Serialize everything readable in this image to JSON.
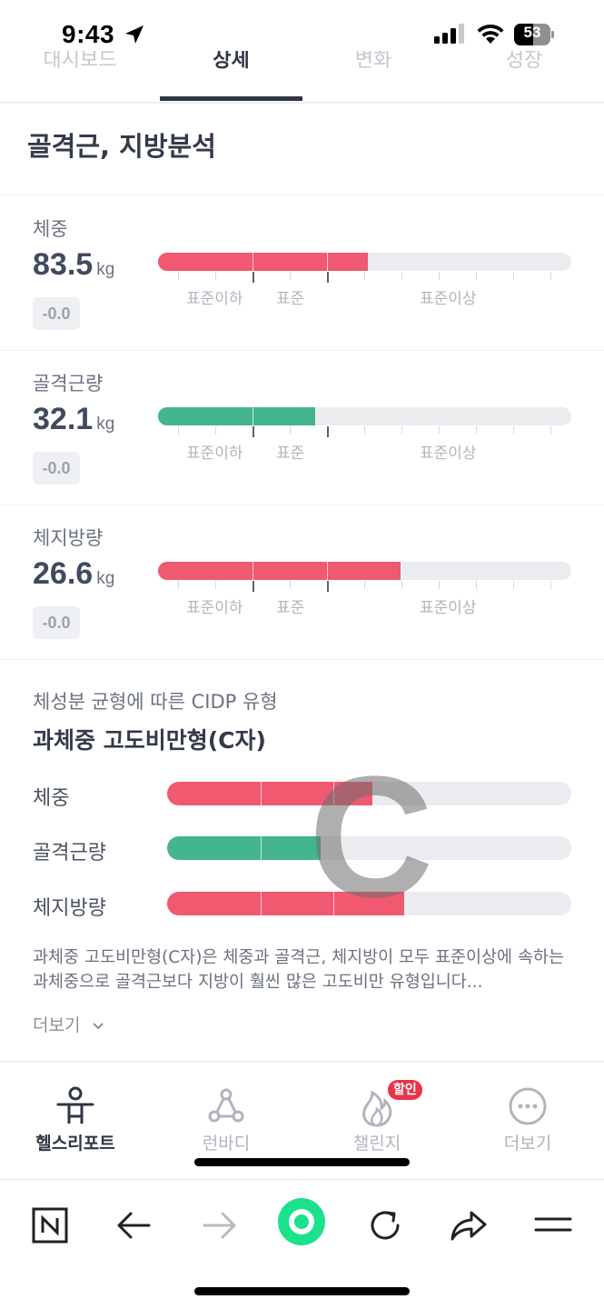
{
  "status_bar": {
    "time": "9:43",
    "battery": "53",
    "battery_level": 0.53
  },
  "tabs": [
    {
      "label": "대시보드",
      "active": false
    },
    {
      "label": "상세",
      "active": true
    },
    {
      "label": "변화",
      "active": false
    },
    {
      "label": "성장",
      "active": false
    }
  ],
  "section_title": "골격근, 지방분석",
  "colors": {
    "over": "#f0596f",
    "normal": "#44b58e",
    "track": "#eaecef"
  },
  "metrics": [
    {
      "label": "체중",
      "value": "83.5",
      "unit": "kg",
      "change": "-0.0",
      "fill_fraction": 0.507,
      "status": "over"
    },
    {
      "label": "골격근량",
      "value": "32.1",
      "unit": "kg",
      "change": "-0.0",
      "fill_fraction": 0.38,
      "status": "normal"
    },
    {
      "label": "체지방량",
      "value": "26.6",
      "unit": "kg",
      "change": "-0.0",
      "fill_fraction": 0.587,
      "status": "over"
    }
  ],
  "range_labels": {
    "below": "표준이하",
    "standard": "표준",
    "above": "표준이상"
  },
  "cidp": {
    "subtitle": "체성분 균형에 따른 CIDP 유형",
    "title": "과체중 고도비만형(C자)",
    "letter": "C",
    "rows": [
      {
        "label": "체중",
        "fill_fraction": 0.507,
        "status": "over"
      },
      {
        "label": "골격근량",
        "fill_fraction": 0.38,
        "status": "normal"
      },
      {
        "label": "체지방량",
        "fill_fraction": 0.587,
        "status": "over"
      }
    ],
    "description": "과체중 고도비만형(C자)은 체중과 골격근, 체지방이 모두 표준이상에 속하는 과체중으로 골격근보다 지방이 훨씬 많은 고도비만 유형입니다...",
    "more_label": "더보기"
  },
  "app_nav": [
    {
      "label": "헬스리포트",
      "icon": "person-icon",
      "active": true
    },
    {
      "label": "런바디",
      "icon": "molecule-icon",
      "active": false
    },
    {
      "label": "챌린지",
      "icon": "flame-icon",
      "active": false,
      "badge": "할인"
    },
    {
      "label": "더보기",
      "icon": "more-dots-icon",
      "active": false
    }
  ],
  "browser_bar": {
    "buttons": [
      "naver-n-icon",
      "back-arrow-icon",
      "forward-arrow-icon",
      "green-home-icon",
      "reload-icon",
      "share-icon",
      "menu-icon"
    ]
  }
}
